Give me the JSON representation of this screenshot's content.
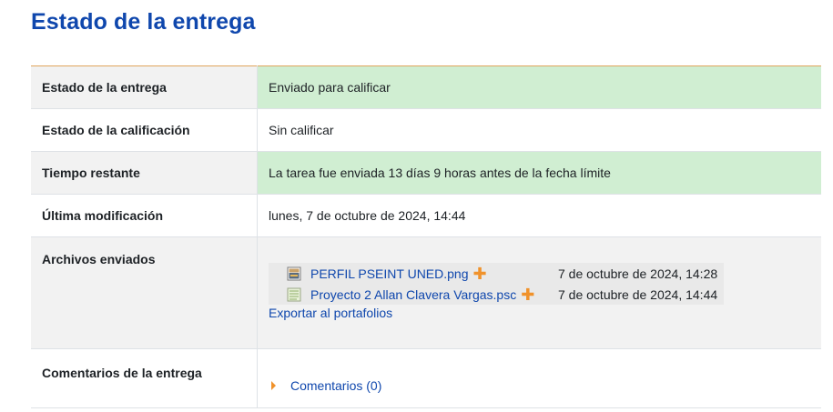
{
  "page_title": "Estado de la entrega",
  "rows": [
    {
      "label": "Estado de la entrega",
      "value": "Enviado para calificar"
    },
    {
      "label": "Estado de la calificación",
      "value": "Sin calificar"
    },
    {
      "label": "Tiempo restante",
      "value": "La tarea fue enviada 13 días 9 horas antes de la fecha límite"
    },
    {
      "label": "Última modificación",
      "value": "lunes, 7 de octubre de 2024, 14:44"
    },
    {
      "label": "Archivos enviados"
    },
    {
      "label": "Comentarios de la entrega"
    }
  ],
  "files": [
    {
      "name": "PERFIL PSEINT UNED.png",
      "date": "7 de octubre de 2024, 14:28",
      "icon": "image-file-icon"
    },
    {
      "name": "Proyecto 2 Allan Clavera Vargas.psc",
      "date": "7 de octubre de 2024, 14:44",
      "icon": "text-file-icon"
    }
  ],
  "plus_symbol": "✚",
  "export_label": "Exportar al portafolios",
  "comments_label": "Comentarios (0)",
  "colors": {
    "heading": "#0f47ad",
    "link": "#0f47ad",
    "success_bg": "#d0eed2",
    "accent_orange": "#f0922b",
    "header_bg": "#f2f2f2"
  }
}
